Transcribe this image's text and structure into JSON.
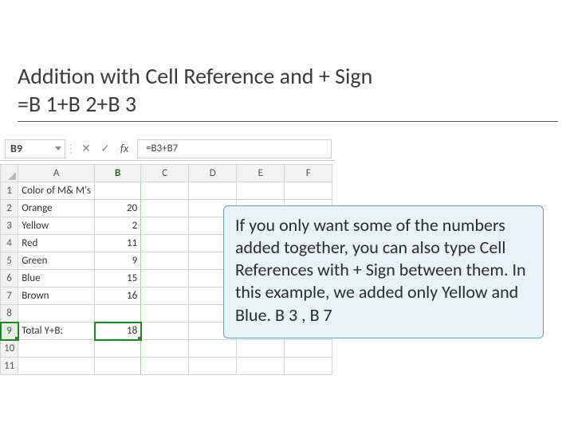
{
  "title": {
    "line1": "Addition with Cell Reference and + Sign",
    "line2": "=B 1+B 2+B 3"
  },
  "formula_bar": {
    "namebox": "B9",
    "formula": "=B3+B7"
  },
  "columns": [
    "A",
    "B",
    "C",
    "D",
    "E",
    "F"
  ],
  "rows": [
    {
      "n": "1",
      "a": "Color of M& M's",
      "b": ""
    },
    {
      "n": "2",
      "a": "Orange",
      "b": "20"
    },
    {
      "n": "3",
      "a": "Yellow",
      "b": "2"
    },
    {
      "n": "4",
      "a": "Red",
      "b": "11"
    },
    {
      "n": "5",
      "a": "Green",
      "b": "9"
    },
    {
      "n": "6",
      "a": "Blue",
      "b": "15"
    },
    {
      "n": "7",
      "a": "Brown",
      "b": "16"
    },
    {
      "n": "8",
      "a": "",
      "b": ""
    },
    {
      "n": "9",
      "a": "Total Y+B:",
      "b": "18"
    },
    {
      "n": "10",
      "a": "",
      "b": ""
    },
    {
      "n": "11",
      "a": "",
      "b": ""
    }
  ],
  "callout": "If you only want some of the numbers added together, you can also type Cell References with + Sign between them. In this example, we added only Yellow and Blue. B 3 , B 7",
  "icons": {
    "cancel": "✕",
    "enter": "✓",
    "fx": "fx",
    "dots": "⋮"
  }
}
